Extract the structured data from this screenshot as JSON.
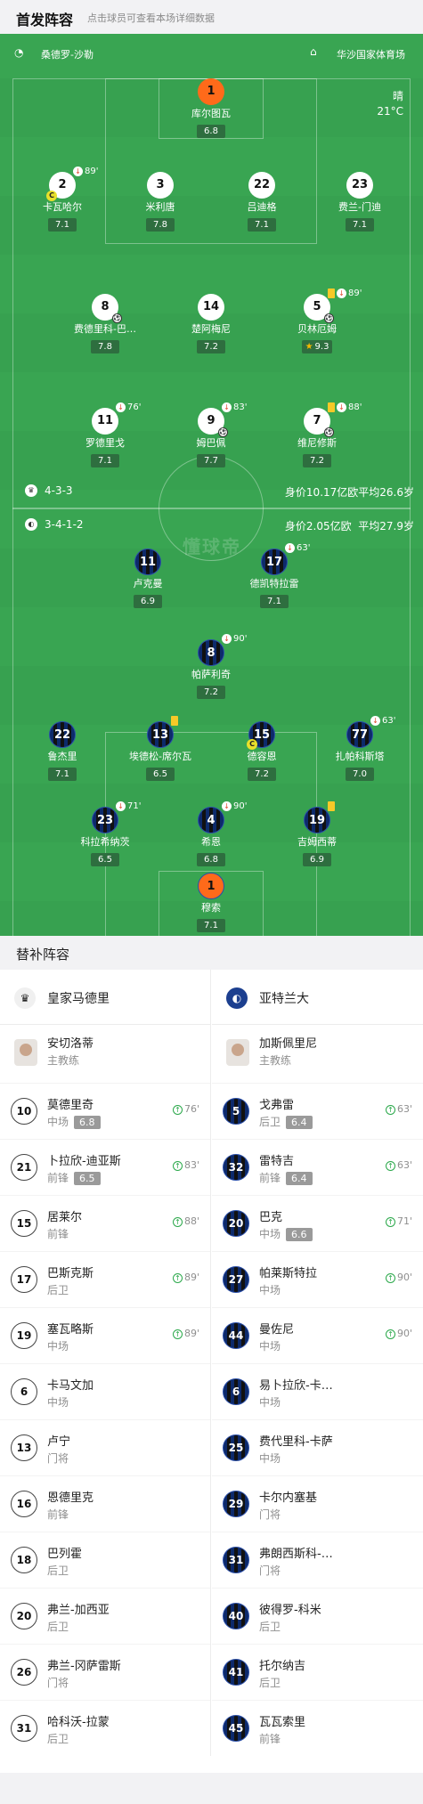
{
  "header": {
    "title": "首发阵容",
    "hint": "点击球员可查看本场详细数据"
  },
  "pitch": {
    "referee": "桑德罗-沙勒",
    "venue": "华沙国家体育场",
    "weather": "晴",
    "temperature": "21°C",
    "watermark": "懂球帝"
  },
  "home": {
    "formation": "4-3-3",
    "value_text": "身价10.17亿欧平均26.6岁",
    "players": [
      {
        "num": "1",
        "name": "库尔图瓦",
        "rating": "6.8",
        "gk": true
      },
      {
        "num": "2",
        "name": "卡瓦哈尔",
        "rating": "7.1",
        "subout": "89'",
        "captain": true
      },
      {
        "num": "3",
        "name": "米利唐",
        "rating": "7.8"
      },
      {
        "num": "22",
        "name": "吕迪格",
        "rating": "7.1"
      },
      {
        "num": "23",
        "name": "费兰-门迪",
        "rating": "7.1"
      },
      {
        "num": "8",
        "name": "费德里科-巴…",
        "rating": "7.8",
        "goal": true
      },
      {
        "num": "14",
        "name": "楚阿梅尼",
        "rating": "7.2"
      },
      {
        "num": "5",
        "name": "贝林厄姆",
        "rating": "9.3",
        "subout": "89'",
        "yellow": true,
        "star": true,
        "goal": true
      },
      {
        "num": "11",
        "name": "罗德里戈",
        "rating": "7.1",
        "subout": "76'"
      },
      {
        "num": "9",
        "name": "姆巴佩",
        "rating": "7.7",
        "subout": "83'",
        "goal": true
      },
      {
        "num": "7",
        "name": "维尼修斯",
        "rating": "7.2",
        "subout": "88'",
        "yellow": true,
        "goal": true
      }
    ]
  },
  "away": {
    "formation": "3-4-1-2",
    "value_text": "身价2.05亿欧",
    "age_text": "平均27.9岁",
    "players": [
      {
        "num": "11",
        "name": "卢克曼",
        "rating": "6.9"
      },
      {
        "num": "17",
        "name": "德凯特拉雷",
        "rating": "7.1",
        "subout": "63'"
      },
      {
        "num": "8",
        "name": "帕萨利奇",
        "rating": "7.2",
        "subout": "90'"
      },
      {
        "num": "22",
        "name": "鲁杰里",
        "rating": "7.1"
      },
      {
        "num": "13",
        "name": "埃德松-席尔瓦",
        "rating": "6.5",
        "yellow": true
      },
      {
        "num": "15",
        "name": "德容恩",
        "rating": "7.2",
        "captain": true
      },
      {
        "num": "77",
        "name": "扎帕科斯塔",
        "rating": "7.0",
        "subout": "63'"
      },
      {
        "num": "23",
        "name": "科拉希纳茨",
        "rating": "6.5",
        "subout": "71'"
      },
      {
        "num": "4",
        "name": "希恩",
        "rating": "6.8",
        "subout": "90'"
      },
      {
        "num": "19",
        "name": "吉姆西蒂",
        "rating": "6.9",
        "yellow": true
      },
      {
        "num": "1",
        "name": "穆索",
        "rating": "7.1",
        "gk": true
      }
    ]
  },
  "subs_title": "替补阵容",
  "left": {
    "team": "皇家马德里",
    "coach": "安切洛蒂",
    "coach_role": "主教练",
    "subs": [
      {
        "num": "10",
        "name": "莫德里奇",
        "pos": "中场",
        "rating": "6.8",
        "min": "76'"
      },
      {
        "num": "21",
        "name": "卜拉欣-迪亚斯",
        "pos": "前锋",
        "rating": "6.5",
        "min": "83'"
      },
      {
        "num": "15",
        "name": "居莱尔",
        "pos": "前锋",
        "min": "88'"
      },
      {
        "num": "17",
        "name": "巴斯克斯",
        "pos": "后卫",
        "min": "89'"
      },
      {
        "num": "19",
        "name": "塞瓦略斯",
        "pos": "中场",
        "min": "89'"
      },
      {
        "num": "6",
        "name": "卡马文加",
        "pos": "中场"
      },
      {
        "num": "13",
        "name": "卢宁",
        "pos": "门将"
      },
      {
        "num": "16",
        "name": "恩德里克",
        "pos": "前锋"
      },
      {
        "num": "18",
        "name": "巴列霍",
        "pos": "后卫"
      },
      {
        "num": "20",
        "name": "弗兰-加西亚",
        "pos": "后卫"
      },
      {
        "num": "26",
        "name": "弗兰-冈萨雷斯",
        "pos": "门将"
      },
      {
        "num": "31",
        "name": "哈科沃-拉蒙",
        "pos": "后卫"
      }
    ]
  },
  "right": {
    "team": "亚特兰大",
    "coach": "加斯佩里尼",
    "coach_role": "主教练",
    "subs": [
      {
        "num": "5",
        "name": "戈弗雷",
        "pos": "后卫",
        "rating": "6.4",
        "min": "63'"
      },
      {
        "num": "32",
        "name": "雷特吉",
        "pos": "前锋",
        "rating": "6.4",
        "min": "63'"
      },
      {
        "num": "20",
        "name": "巴克",
        "pos": "中场",
        "rating": "6.6",
        "min": "71'"
      },
      {
        "num": "27",
        "name": "帕莱斯特拉",
        "pos": "中场",
        "min": "90'"
      },
      {
        "num": "44",
        "name": "曼佐尼",
        "pos": "中场",
        "min": "90'"
      },
      {
        "num": "6",
        "name": "易卜拉欣-卡…",
        "pos": "中场"
      },
      {
        "num": "25",
        "name": "费代里科-卡萨",
        "pos": "中场"
      },
      {
        "num": "29",
        "name": "卡尔内塞基",
        "pos": "门将"
      },
      {
        "num": "31",
        "name": "弗朗西斯科-…",
        "pos": "门将"
      },
      {
        "num": "40",
        "name": "彼得罗-科米",
        "pos": "后卫"
      },
      {
        "num": "41",
        "name": "托尔纳吉",
        "pos": "后卫"
      },
      {
        "num": "45",
        "name": "瓦瓦索里",
        "pos": "前锋"
      }
    ]
  }
}
